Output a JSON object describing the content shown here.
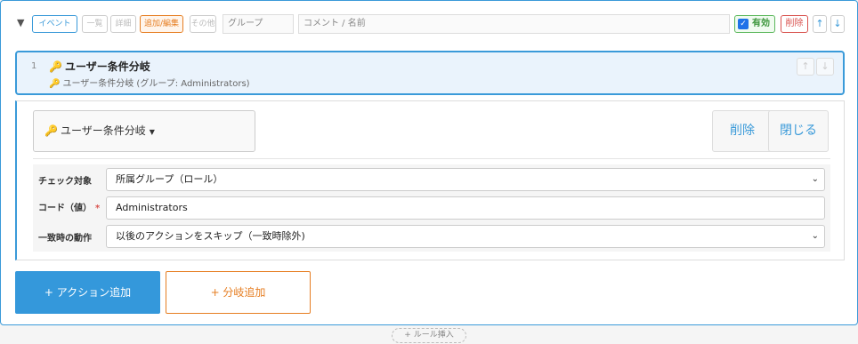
{
  "header": {
    "tags": [
      {
        "label": "イベント",
        "style": "active"
      },
      {
        "label": "一覧",
        "style": "dim"
      },
      {
        "label": "詳細",
        "style": "dim"
      },
      {
        "label": "追加/編集",
        "style": "orange"
      },
      {
        "label": "その他",
        "style": "dim"
      }
    ],
    "group_field": "グループ",
    "comment_field": "コメント / 名前",
    "valid_label": "有効",
    "delete_label": "削除",
    "up_label": "↑",
    "down_label": "↓"
  },
  "rule": {
    "number": "1",
    "title": "ユーザー条件分岐",
    "subtitle": "ユーザー条件分岐 (グループ: Administrators)"
  },
  "editor": {
    "type_select": "ユーザー条件分岐",
    "delete_label": "削除",
    "close_label": "閉じる",
    "fields": {
      "check_target": {
        "label": "チェック対象",
        "value": "所属グループ（ロール）"
      },
      "code_value": {
        "label": "コード（値）",
        "required_mark": "*",
        "value": "Administrators"
      },
      "match_action": {
        "label": "一致時の動作",
        "value": "以後のアクションをスキップ（一致時除外)"
      }
    }
  },
  "buttons": {
    "add_action": "+ アクション追加",
    "add_branch": "+ 分岐追加",
    "insert_rule": "+ ルール挿入"
  },
  "colors": {
    "accent": "#3a9ad9",
    "orange": "#e67e22",
    "green": "#5cb85c",
    "red": "#d9534f"
  }
}
